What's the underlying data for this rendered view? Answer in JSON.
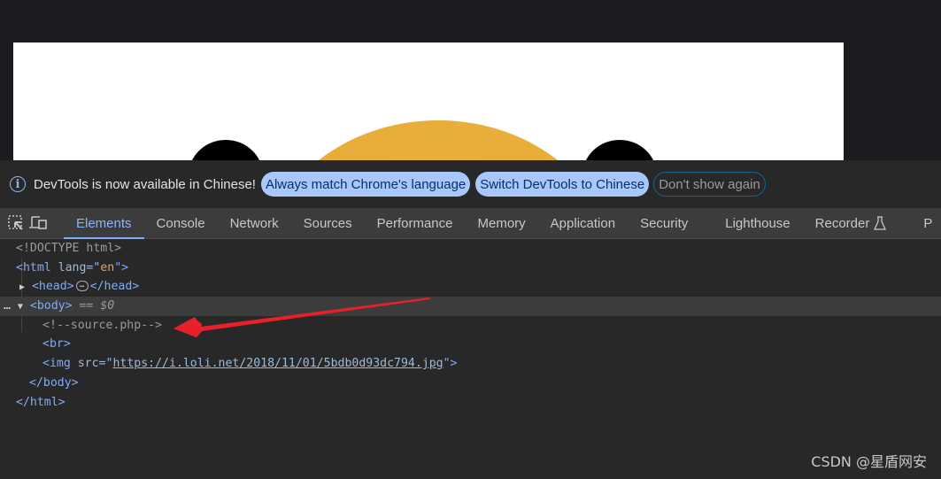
{
  "infobar": {
    "message": "DevTools is now available in Chinese!",
    "buttons": [
      "Always match Chrome's language",
      "Switch DevTools to Chinese",
      "Don't show again"
    ]
  },
  "toolbar": {
    "icons": [
      "inspect-element-icon",
      "device-toolbar-icon"
    ]
  },
  "tabs": [
    {
      "label": "Elements",
      "active": true
    },
    {
      "label": "Console"
    },
    {
      "label": "Network"
    },
    {
      "label": "Sources"
    },
    {
      "label": "Performance"
    },
    {
      "label": "Memory"
    },
    {
      "label": "Application"
    },
    {
      "label": "Security"
    },
    {
      "label": "Lighthouse"
    },
    {
      "label": "Recorder"
    },
    {
      "label": "P"
    }
  ],
  "dom": {
    "doctype": "<!DOCTYPE html>",
    "html_open_tag": "<html",
    "html_attr": "lang",
    "html_attr_eq": "=\"",
    "html_attr_value": "en",
    "html_close_quote": "\">",
    "head_open": "<head>",
    "head_ellipsis": "…",
    "head_close": "</head>",
    "row_ellipsis": "…",
    "body_open": "<body>",
    "body_selected_marker": "== $0",
    "comment": "<!--source.php-->",
    "br": "<br>",
    "img_open": "<img",
    "img_attr": "src",
    "img_attr_eq": "=\"",
    "img_src": "https://i.loli.net/2018/11/01/5bdb0d93dc794.jpg",
    "img_close": "\">",
    "body_close": "</body>",
    "html_close": "</html>"
  },
  "watermark": "CSDN @星盾网安",
  "colors": {
    "accent": "#8ab4f8",
    "pill_bg": "#a8c7fa",
    "annotation_arrow": "#e8202a"
  }
}
